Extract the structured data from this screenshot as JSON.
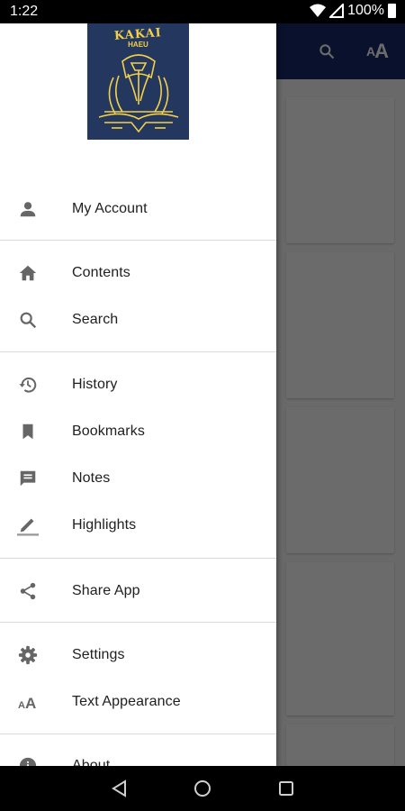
{
  "status_bar": {
    "time": "1:22",
    "battery": "100%"
  },
  "app": {
    "toolbar": {
      "search_icon": "search-icon",
      "text_icon_label": "AA"
    }
  },
  "drawer": {
    "cover": {
      "title": "KAKAI",
      "subtitle": "HAEU"
    },
    "items": [
      {
        "label": "My Account",
        "icon": "person-icon"
      },
      {
        "label": "Contents",
        "icon": "home-icon"
      },
      {
        "label": "Search",
        "icon": "search-icon"
      },
      {
        "label": "History",
        "icon": "history-icon"
      },
      {
        "label": "Bookmarks",
        "icon": "bookmark-icon"
      },
      {
        "label": "Notes",
        "icon": "note-icon"
      },
      {
        "label": "Highlights",
        "icon": "highlight-icon"
      },
      {
        "label": "Share App",
        "icon": "share-icon"
      },
      {
        "label": "Settings",
        "icon": "gear-icon"
      },
      {
        "label": "Text Appearance",
        "icon": "text-size-icon"
      },
      {
        "label": "About",
        "icon": "info-icon"
      }
    ]
  },
  "colors": {
    "toolbar": "#1a2a6c",
    "cover": "#24375f",
    "cover_gold": "#f2d04a",
    "icon": "#666666"
  }
}
